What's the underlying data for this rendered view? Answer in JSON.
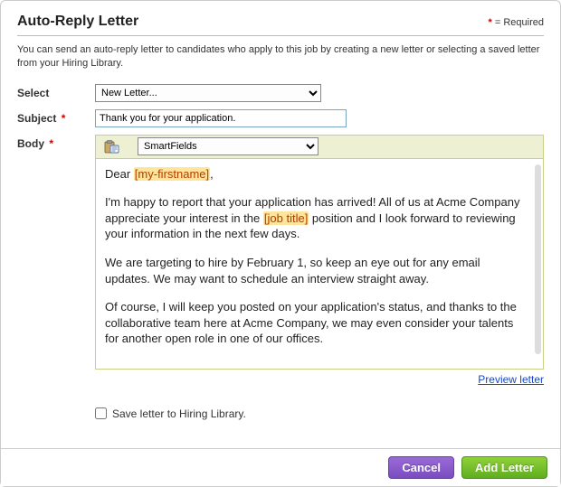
{
  "header": {
    "title": "Auto-Reply Letter",
    "required_legend": "= Required"
  },
  "intro": "You can send an auto-reply letter to candidates who apply to this job by creating a new letter or selecting a saved letter from your Hiring Library.",
  "labels": {
    "select": "Select",
    "subject": "Subject",
    "body": "Body"
  },
  "select": {
    "selected": "New Letter..."
  },
  "subject": {
    "value": "Thank you for your application."
  },
  "toolbar": {
    "smartfields_selected": "SmartFields"
  },
  "body": {
    "greeting_pre": "Dear ",
    "greeting_token": "[my-firstname]",
    "greeting_post": ",",
    "p1_pre": "I'm happy to report that your application has arrived! All of us at Acme Company appreciate your interest in the ",
    "p1_token": "[job title]",
    "p1_post": " position and I look forward to reviewing your information in the next few days.",
    "p2": "We are targeting to hire by February 1, so keep an eye out for any email updates. We may want to schedule an interview straight away.",
    "p3": "Of course, I will keep you posted on your application's status, and thanks to the collaborative team here at Acme Company, we may even consider your talents for another open role in one of our offices."
  },
  "preview": {
    "link": "Preview letter"
  },
  "save": {
    "label": "Save letter to Hiring Library."
  },
  "footer": {
    "cancel": "Cancel",
    "add": "Add Letter"
  }
}
